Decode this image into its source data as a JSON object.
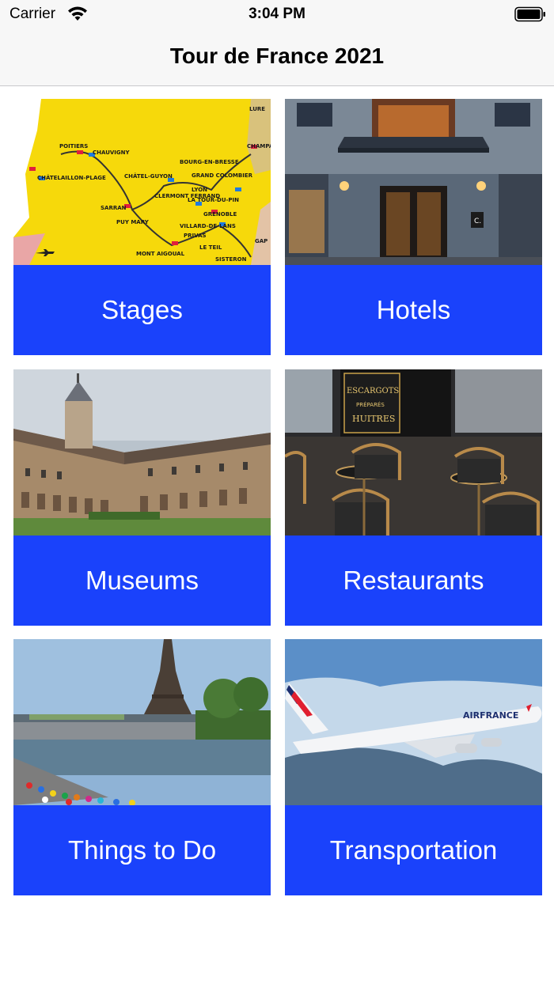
{
  "status_bar": {
    "carrier": "Carrier",
    "time": "3:04 PM"
  },
  "nav": {
    "title": "Tour de France 2021"
  },
  "theme": {
    "tile_color": "#1a42fb",
    "label_color": "#ffffff"
  },
  "tiles": [
    {
      "label": "Stages",
      "image": "route-map-photo"
    },
    {
      "label": "Hotels",
      "image": "hotel-entrance-photo"
    },
    {
      "label": "Museums",
      "image": "abbey-cloister-photo"
    },
    {
      "label": "Restaurants",
      "image": "cafe-terrace-photo"
    },
    {
      "label": "Things to Do",
      "image": "eiffel-tower-seine-photo"
    },
    {
      "label": "Transportation",
      "image": "air-france-plane-photo"
    }
  ],
  "map_labels": [
    "POITIERS",
    "CHAUVIGNY",
    "CHÂTEL-GUYON",
    "LYON",
    "GRAND COLOMBIER",
    "SARRAN",
    "PUY MARY",
    "PRIVAS",
    "MONT AIGOUAL",
    "SISTERON",
    "LURE",
    "CHAMPAG",
    "BOURG-EN-BRESSE",
    "CLERMONT FERRAND",
    "GRENOBLE",
    "VILLARD-DE-LANS",
    "LA TOUR-DU-PIN",
    "LE TEIL",
    "GAP",
    "CHÂTELAILLON-PLAGE"
  ],
  "photo_text": {
    "hotel_sign": "C.",
    "cafe_sign_1": "ESCARGOTS",
    "cafe_sign_2": "PRÉPARÉS",
    "cafe_sign_3": "HUITRES",
    "airline": "AIRFRANCE"
  }
}
